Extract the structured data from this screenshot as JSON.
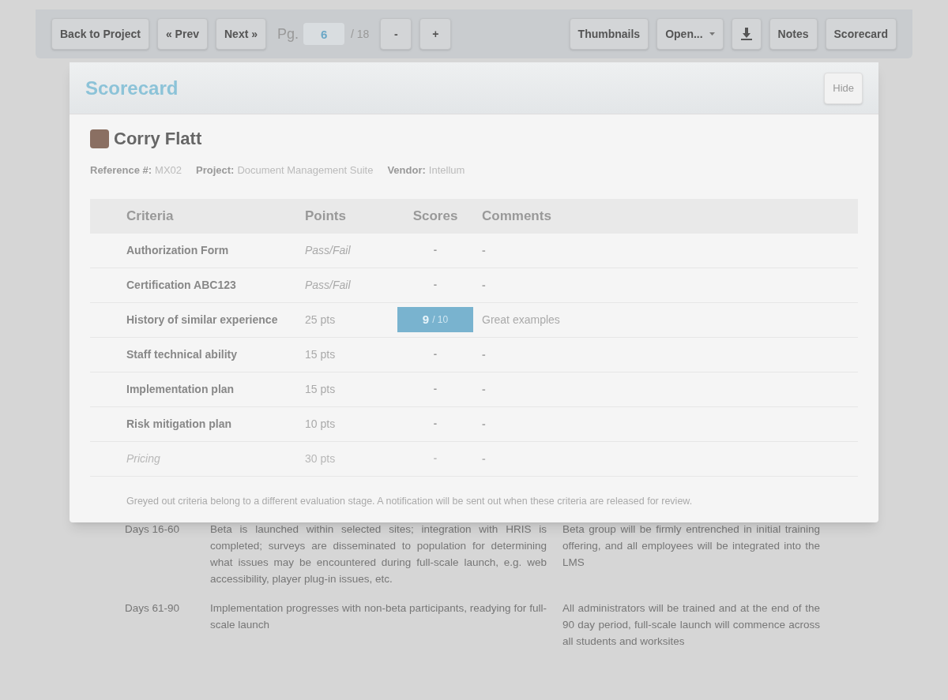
{
  "toolbar": {
    "left_buttons": [
      {
        "label": "Back to Project"
      },
      {
        "label": "« Prev"
      },
      {
        "label": "Next »"
      }
    ],
    "page_label": "Pg.",
    "page_value": "6",
    "page_total": "/ 18",
    "zoom_buttons": [
      {
        "label": "-"
      },
      {
        "label": "+"
      }
    ],
    "right_buttons": [
      {
        "kind": "text",
        "label": "Thumbnails"
      },
      {
        "kind": "dropdown",
        "label": "Open..."
      },
      {
        "kind": "download"
      },
      {
        "kind": "text",
        "label": "Notes"
      },
      {
        "kind": "text",
        "label": "Scorecard"
      }
    ]
  },
  "document": {
    "rows": [
      {
        "period": "Days 16-60",
        "activity": "Beta is launched within selected sites; integration with HRIS is completed; surveys are disseminated to population for determining what issues may be encountered during full-scale launch, e.g. web accessibility, player plug-in issues, etc.",
        "outcome": "Beta group will be firmly entrenched in initial training offering, and all employees will be integrated into the LMS"
      },
      {
        "period": "Days 61-90",
        "activity": "Implementation progresses with non-beta participants, readying for full-scale launch",
        "outcome": "All administrators will be trained and at the end of the 90 day period, full-scale launch will commence across all students and worksites"
      }
    ]
  },
  "scorecard": {
    "title": "Scorecard",
    "hide_button": "Hide",
    "name": "Corry Flatt",
    "meta": [
      {
        "label": "Reference #:",
        "value": "MX02"
      },
      {
        "label": "Project:",
        "value": "Document Management Suite"
      },
      {
        "label": "Vendor:",
        "value": "Intellum"
      }
    ],
    "columns": [
      "Criteria",
      "Points",
      "Scores",
      "Comments"
    ],
    "rows": [
      {
        "criteria": "Authorization Form",
        "points": "Pass/Fail",
        "score": "-",
        "comment": "-",
        "disabled": false
      },
      {
        "criteria": "Certification ABC123",
        "points": "Pass/Fail",
        "score": "-",
        "comment": "-",
        "disabled": false
      },
      {
        "criteria": "History of similar experience",
        "points": "25 pts",
        "score": "9",
        "score_max": "/ 10",
        "comment": "Great examples",
        "disabled": false
      },
      {
        "criteria": "Staff technical ability",
        "points": "15 pts",
        "score": "-",
        "comment": "-",
        "disabled": false
      },
      {
        "criteria": "Implementation plan",
        "points": "15 pts",
        "score": "-",
        "comment": "-",
        "disabled": false
      },
      {
        "criteria": "Risk mitigation plan",
        "points": "10 pts",
        "score": "-",
        "comment": "-",
        "disabled": false
      },
      {
        "criteria": "Pricing",
        "points": "30 pts",
        "score": "-",
        "comment": "-",
        "disabled": true
      }
    ],
    "footnote": "Greyed out criteria belong to a different evaluation stage. A notification will be sent out when these criteria are released for review."
  }
}
